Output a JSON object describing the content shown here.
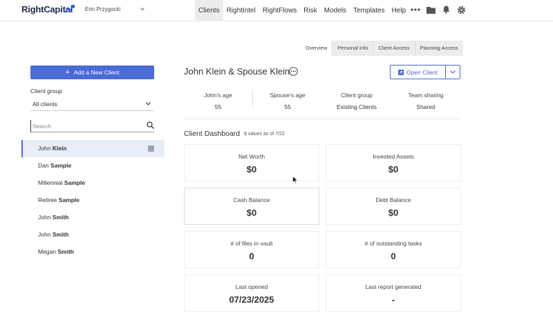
{
  "app": {
    "logo_text": "RightCapital"
  },
  "user": {
    "name": "Erin Przygocki"
  },
  "nav": {
    "items": [
      {
        "label": "Clients",
        "active": true
      },
      {
        "label": "RightIntel",
        "active": false
      },
      {
        "label": "RightFlows",
        "active": false
      },
      {
        "label": "Risk",
        "active": false
      },
      {
        "label": "Models",
        "active": false
      },
      {
        "label": "Templates",
        "active": false
      },
      {
        "label": "Help",
        "active": false
      }
    ],
    "icons": [
      "more-icon",
      "folder-icon",
      "bell-icon",
      "gear-icon"
    ]
  },
  "sidebar": {
    "add_client_label": "Add a New Client",
    "client_group_label": "Client group",
    "client_group_value": "All clients",
    "search_placeholder": "Search",
    "clients": [
      {
        "first": "John",
        "last": "Klein",
        "selected": true
      },
      {
        "first": "Dan",
        "last": "Sample",
        "selected": false
      },
      {
        "first": "Millennial",
        "last": "Sample",
        "selected": false
      },
      {
        "first": "Retiree",
        "last": "Sample",
        "selected": false
      },
      {
        "first": "John",
        "last": "Smith",
        "selected": false
      },
      {
        "first": "John",
        "last": "Smith",
        "selected": false
      },
      {
        "first": "Megan",
        "last": "Smith",
        "selected": false
      }
    ]
  },
  "tabs": [
    {
      "label": "Overview",
      "active": true
    },
    {
      "label": "Personal Info",
      "active": false
    },
    {
      "label": "Client Access",
      "active": false
    },
    {
      "label": "Planning Access",
      "active": false
    }
  ],
  "client": {
    "name": "John Klein & Spouse Klein",
    "open_client_label": "Open Client",
    "summary": [
      {
        "label": "John's age",
        "value": "55"
      },
      {
        "label": "Spouse's age",
        "value": "55"
      },
      {
        "label": "Client group",
        "value": "Existing Clients"
      },
      {
        "label": "Team sharing",
        "value": "Shared"
      }
    ]
  },
  "dashboard": {
    "title": "Client Dashboard",
    "subtitle": "$ values as of 7/22",
    "cards": [
      {
        "label": "Net Worth",
        "value": "$0"
      },
      {
        "label": "Invested Assets",
        "value": "$0"
      },
      {
        "label": "Cash Balance",
        "value": "$0"
      },
      {
        "label": "Debt Balance",
        "value": "$0"
      },
      {
        "label": "# of files in vault",
        "value": "0"
      },
      {
        "label": "# of outstanding tasks",
        "value": "0"
      },
      {
        "label": "Last opened",
        "value": "07/23/2025"
      },
      {
        "label": "Last report generated",
        "value": "-"
      }
    ]
  },
  "colors": {
    "accent": "#4a6ad6",
    "nav_active_bg": "#ececec",
    "selected_row_bg": "#e9edf8"
  }
}
